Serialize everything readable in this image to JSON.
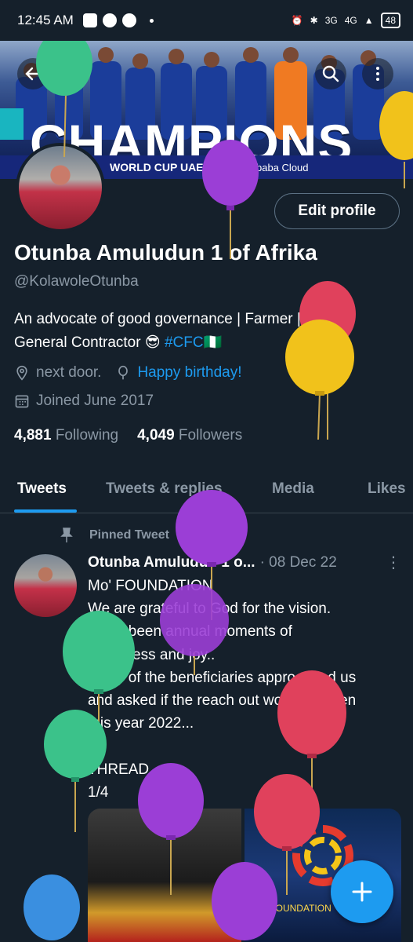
{
  "status_bar": {
    "time": "12:45 AM",
    "network_labels": [
      "3G",
      "4G"
    ],
    "battery": "48"
  },
  "banner": {
    "headline": "CHAMPIONS",
    "strip_text": "WORLD CUP UAE 2021",
    "sponsor": "Alibaba Cloud"
  },
  "profile": {
    "edit_label": "Edit profile",
    "display_name": "Otunba Amuludun 1 of Afrika",
    "handle": "@KolawoleOtunba",
    "bio_line1": "An advocate of good governance | Farmer |",
    "bio_line2_prefix": "General Contractor 😎 ",
    "bio_hashtag": "#CFC",
    "bio_flag": "🇳🇬",
    "location": "next door.",
    "birthday": "Happy birthday!",
    "joined": "Joined June 2017",
    "following_count": "4,881",
    "following_label": "Following",
    "followers_count": "4,049",
    "followers_label": "Followers"
  },
  "tabs": [
    {
      "label": "Tweets",
      "active": true
    },
    {
      "label": "Tweets & replies",
      "active": false
    },
    {
      "label": "Media",
      "active": false
    },
    {
      "label": "Likes",
      "active": false
    }
  ],
  "tweet": {
    "pinned_label": "Pinned Tweet",
    "author": "Otunba Amuludun 1 o...",
    "date": "· 08 Dec 22",
    "body": "Mo' FOUNDATION\nWe are grateful to God for the vision.\nIt has been annual moments of\nhappiness and joy..\nMany of the beneficiaries approached us\nand asked if the reach out would happen\nthis year 2022...\n\nTHREAD\n1/4",
    "media2_text": "Mo' FOUNDATION"
  },
  "colors": {
    "background": "#15202b",
    "accent": "#1d9bf0",
    "muted": "#8b98a5"
  },
  "icons": {
    "back": "arrow-left-icon",
    "search": "search-icon",
    "more": "more-vertical-icon",
    "location": "location-pin-icon",
    "birthday": "balloon-icon",
    "calendar": "calendar-icon",
    "pin": "pin-icon",
    "compose": "plus-icon"
  }
}
